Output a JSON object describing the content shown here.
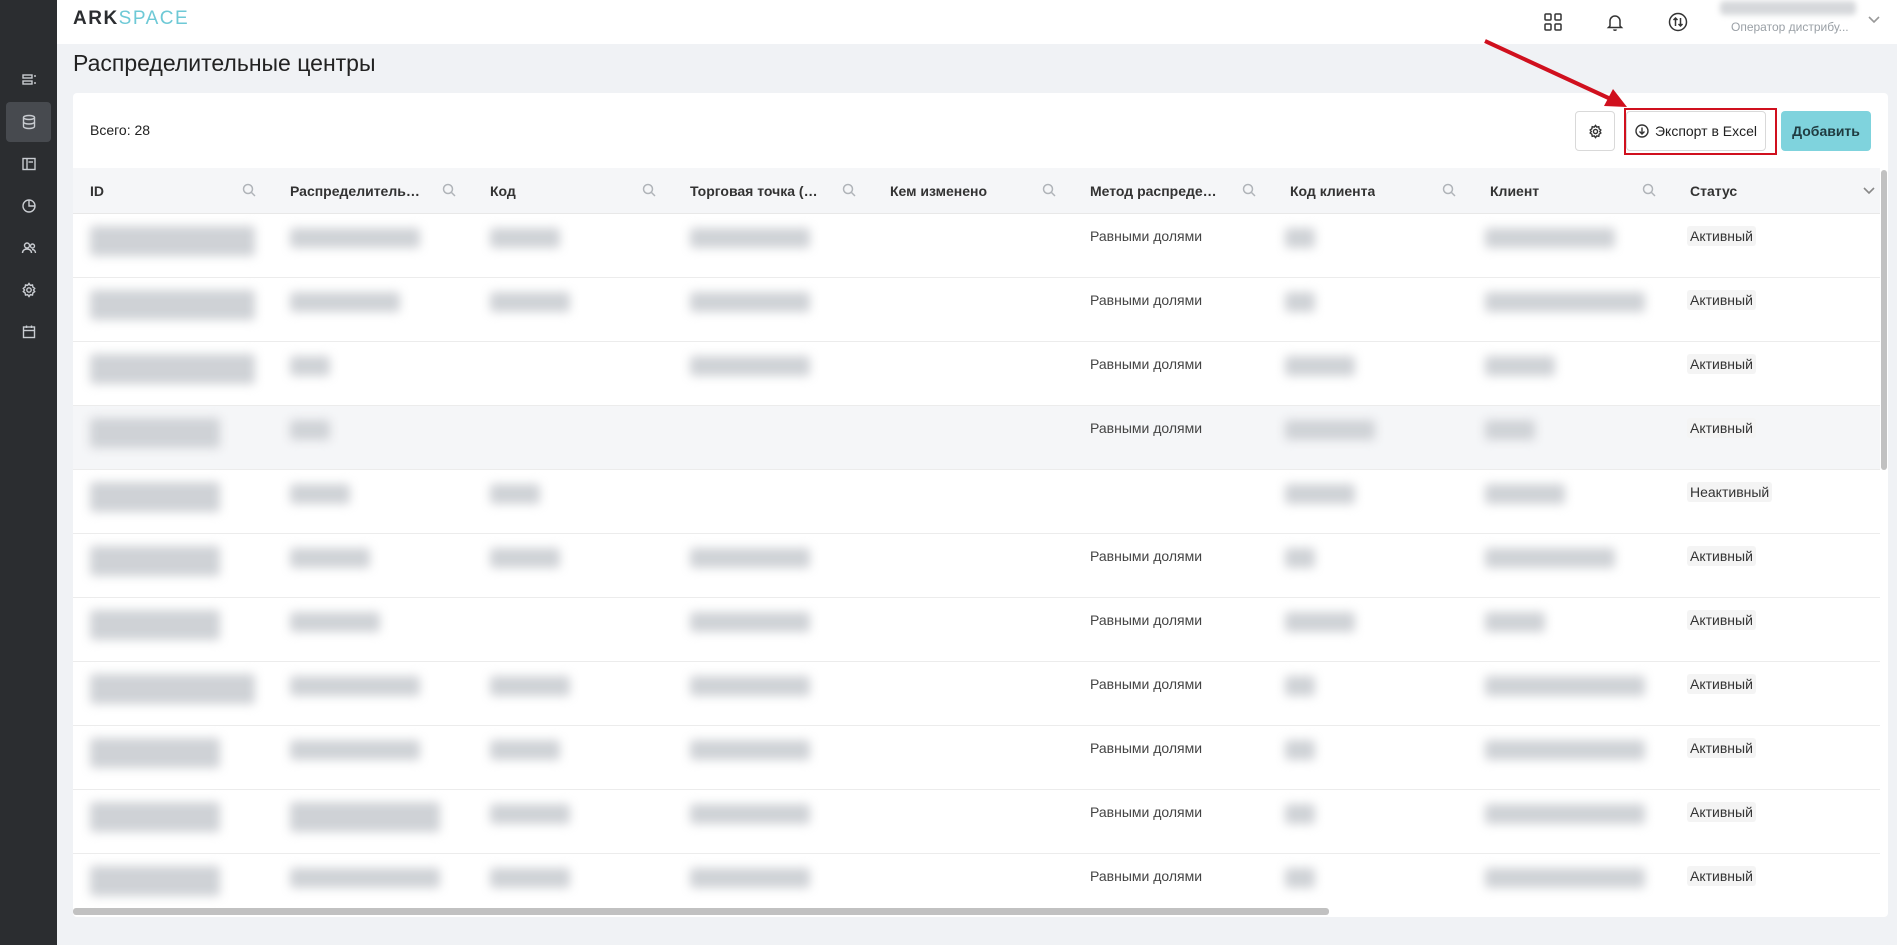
{
  "app": {
    "logo_primary": "ARK",
    "logo_secondary": "SPACE"
  },
  "user": {
    "role": "Оператор дистрибу..."
  },
  "page": {
    "title": "Распределительные центры"
  },
  "toolbar": {
    "total": "Всего: 28",
    "export_label": "Экспорт в Excel",
    "add_label": "Добавить"
  },
  "table": {
    "columns": [
      "ID",
      "Распределительн...",
      "Код",
      "Торговая точка (о...",
      "Кем изменено",
      "Метод распредел...",
      "Код клиента",
      "Клиент",
      "Статус"
    ],
    "rows": [
      {
        "method": "Равными долями",
        "status": "Активный"
      },
      {
        "method": "Равными долями",
        "status": "Активный"
      },
      {
        "method": "Равными долями",
        "status": "Активный"
      },
      {
        "method": "Равными долями",
        "status": "Активный"
      },
      {
        "method": "",
        "status": "Неактивный"
      },
      {
        "method": "Равными долями",
        "status": "Активный"
      },
      {
        "method": "Равными долями",
        "status": "Активный"
      },
      {
        "method": "Равными долями",
        "status": "Активный"
      },
      {
        "method": "Равными долями",
        "status": "Активный"
      },
      {
        "method": "Равными долями",
        "status": "Активный"
      },
      {
        "method": "Равными долями",
        "status": "Активный"
      }
    ]
  },
  "colors": {
    "accent": "#7fd3dd",
    "sidebar": "#2b2d30",
    "highlight": "#d0101e"
  },
  "icons": [
    "list-icon",
    "database-icon",
    "layout-icon",
    "chart-icon",
    "users-icon",
    "gear-icon",
    "calendar-icon",
    "grid-icon",
    "bell-icon",
    "sync-icon",
    "download-icon",
    "search-icon",
    "chevron-down-icon"
  ]
}
